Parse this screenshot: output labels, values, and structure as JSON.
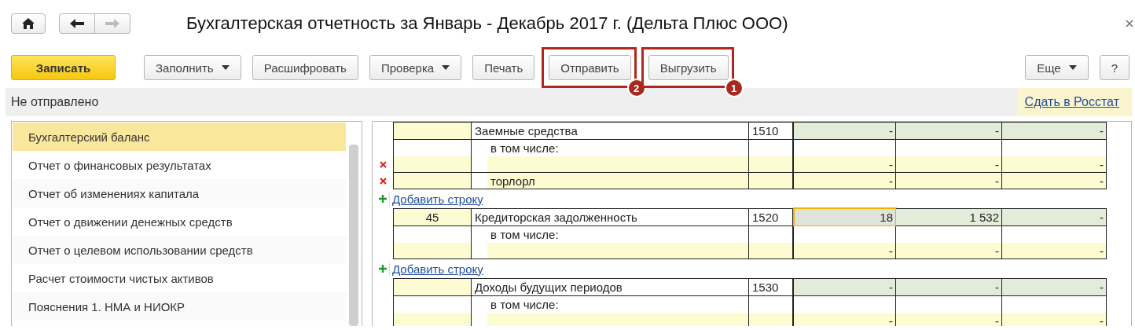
{
  "window": {
    "title": "Бухгалтерская отчетность за Январь - Декабрь 2017 г. (Дельта Плюс ООО)"
  },
  "nav": [
    {
      "kind": "home",
      "disabled": false
    },
    {
      "kind": "back",
      "disabled": false
    },
    {
      "kind": "forward",
      "disabled": true
    }
  ],
  "toolbar": {
    "buttons": [
      {
        "label": "Записать",
        "kind": "primary"
      },
      {
        "label": "Заполнить",
        "kind": "dropdown"
      },
      {
        "label": "Расшифровать",
        "kind": "plain"
      },
      {
        "label": "Проверка",
        "kind": "dropdown"
      },
      {
        "label": "Печать",
        "kind": "plain"
      },
      {
        "label": "Отправить",
        "kind": "plain",
        "callout": "2"
      },
      {
        "label": "Выгрузить",
        "kind": "plain",
        "callout": "1"
      }
    ],
    "right_buttons": [
      {
        "label": "Еще",
        "kind": "dropdown"
      },
      {
        "label": "?",
        "kind": "plain"
      }
    ]
  },
  "status_bar": {
    "text": "Не отправлено",
    "link": "Сдать в Росстат"
  },
  "sidebar": {
    "items": [
      {
        "label": "Бухгалтерский баланс",
        "selected": true
      },
      {
        "label": "Отчет о финансовых результатах",
        "selected": false
      },
      {
        "label": "Отчет об изменениях капитала",
        "selected": false
      },
      {
        "label": "Отчет о движении денежных средств",
        "selected": false
      },
      {
        "label": "Отчет о целевом использовании средств",
        "selected": false
      },
      {
        "label": "Расчет стоимости чистых активов",
        "selected": false
      },
      {
        "label": "Пояснения 1. НМА и НИОКР",
        "selected": false
      }
    ]
  },
  "table": {
    "rows": [
      {
        "kind": "line",
        "number": "",
        "name": "Заемные средства",
        "code": "1510",
        "values": [
          {
            "text": "-",
            "selected": false
          },
          {
            "text": "-",
            "selected": false
          },
          {
            "text": "-",
            "selected": false
          }
        ]
      },
      {
        "kind": "detail",
        "name": "в том числе:",
        "deletable": true,
        "values": [
          {
            "text": "-",
            "selected": false
          },
          {
            "text": "-",
            "selected": false
          },
          {
            "text": "-",
            "selected": false
          }
        ]
      },
      {
        "kind": "item",
        "name": "торлорл",
        "deletable": true,
        "values": [
          {
            "text": "-",
            "selected": false
          },
          {
            "text": "-",
            "selected": false
          },
          {
            "text": "-",
            "selected": false
          }
        ]
      },
      {
        "kind": "add",
        "label": "Добавить строку"
      },
      {
        "kind": "line",
        "number": "45",
        "name": "Кредиторская задолженность",
        "code": "1520",
        "values": [
          {
            "text": "18",
            "selected": true
          },
          {
            "text": "1 532",
            "selected": false
          },
          {
            "text": "-",
            "selected": false
          }
        ]
      },
      {
        "kind": "detail",
        "name": "в том числе:",
        "deletable": false,
        "values": [
          {
            "text": "-",
            "selected": false
          },
          {
            "text": "-",
            "selected": false
          },
          {
            "text": "-",
            "selected": false
          }
        ]
      },
      {
        "kind": "add",
        "label": "Добавить строку"
      },
      {
        "kind": "line",
        "number": "",
        "name": "Доходы будущих периодов",
        "code": "1530",
        "values": [
          {
            "text": "-",
            "selected": false
          },
          {
            "text": "-",
            "selected": false
          },
          {
            "text": "-",
            "selected": false
          }
        ]
      },
      {
        "kind": "detail",
        "name": "в том числе:",
        "deletable": false,
        "values": [
          {
            "text": "-",
            "selected": false
          },
          {
            "text": "-",
            "selected": false
          },
          {
            "text": "-",
            "selected": false
          }
        ]
      }
    ]
  }
}
